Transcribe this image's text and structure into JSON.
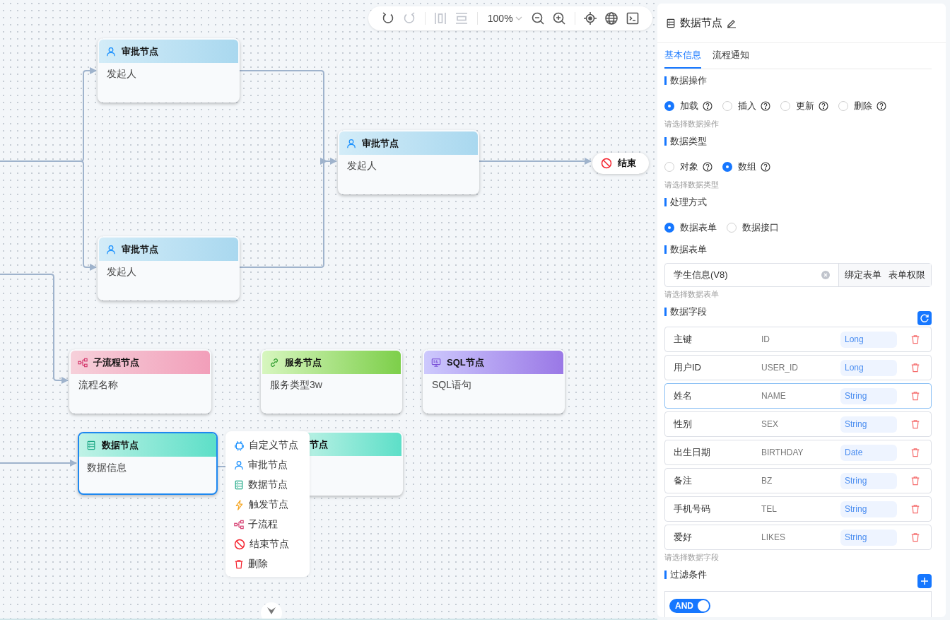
{
  "toolbar": {
    "items": [
      {
        "kind": "undo",
        "disabled": false
      },
      {
        "kind": "redo",
        "disabled": true
      },
      {
        "kind": "sep"
      },
      {
        "kind": "align-v",
        "disabled": true
      },
      {
        "kind": "align-h",
        "disabled": true
      },
      {
        "kind": "sep"
      },
      {
        "kind": "zoom",
        "label": "100%"
      },
      {
        "kind": "zoom-out",
        "disabled": false
      },
      {
        "kind": "zoom-in",
        "disabled": false
      },
      {
        "kind": "sep"
      },
      {
        "kind": "locate",
        "disabled": false
      },
      {
        "kind": "globe",
        "disabled": false
      },
      {
        "kind": "terminal",
        "disabled": false
      }
    ]
  },
  "canvas": {
    "nodes": [
      {
        "kind": "approval",
        "title": "审批节点",
        "body": "发起人",
        "selected": false,
        "covered": false
      },
      {
        "kind": "approval",
        "title": "审批节点",
        "body": "发起人",
        "selected": false,
        "covered": false
      },
      {
        "kind": "approval",
        "title": "审批节点",
        "body": "发起人",
        "selected": false,
        "covered": false
      },
      {
        "kind": "subflow",
        "title": "子流程节点",
        "body": "流程名称",
        "selected": false,
        "covered": false
      },
      {
        "kind": "service",
        "title": "服务节点",
        "body": "服务类型3w",
        "selected": false,
        "covered": false
      },
      {
        "kind": "sql",
        "title": "SQL节点",
        "body": "SQL语句",
        "selected": false,
        "covered": false
      },
      {
        "kind": "data",
        "title": "数据节点",
        "body": "数据信息",
        "selected": true,
        "covered": false
      },
      {
        "kind": "data",
        "title": "节点",
        "selected": false,
        "covered": true
      }
    ],
    "end_node": {
      "label": "结束"
    },
    "context_menu": {
      "items": [
        {
          "kind": "custom",
          "label": "自定义节点"
        },
        {
          "kind": "approval",
          "label": "审批节点"
        },
        {
          "kind": "data",
          "label": "数据节点"
        },
        {
          "kind": "trigger",
          "label": "触发节点"
        },
        {
          "kind": "subflow",
          "label": "子流程"
        },
        {
          "kind": "end",
          "label": "结束节点"
        },
        {
          "kind": "delete",
          "label": "删除"
        }
      ]
    }
  },
  "panel": {
    "title": "数据节点",
    "tabs": [
      {
        "label": "基本信息",
        "selected": true
      },
      {
        "label": "流程通知",
        "selected": false
      }
    ],
    "sections": [
      {
        "kind": "radio",
        "title": "数据操作",
        "options": [
          {
            "label": "加载",
            "help": true,
            "selected": true
          },
          {
            "label": "插入",
            "help": true,
            "selected": false
          },
          {
            "label": "更新",
            "help": true,
            "selected": false
          },
          {
            "label": "删除",
            "help": true,
            "selected": false
          }
        ],
        "hint": "请选择数据操作"
      },
      {
        "kind": "radio",
        "title": "数据类型",
        "options": [
          {
            "label": "对象",
            "help": true,
            "selected": false
          },
          {
            "label": "数组",
            "help": true,
            "selected": true
          }
        ],
        "hint": "请选择数据类型"
      },
      {
        "kind": "radio",
        "title": "处理方式",
        "options": [
          {
            "label": "数据表单",
            "help": false,
            "selected": true
          },
          {
            "label": "数据接口",
            "help": false,
            "selected": false
          }
        ]
      },
      {
        "kind": "select",
        "title": "数据表单",
        "value": "学生信息(V8)",
        "buttons": [
          "绑定表单",
          "表单权限"
        ],
        "hint": "请选择数据表单"
      },
      {
        "kind": "fields",
        "title": "数据字段",
        "rows": [
          {
            "label": "主键",
            "code": "ID",
            "type": "Long",
            "selected": false
          },
          {
            "label": "用户ID",
            "code": "USER_ID",
            "type": "Long",
            "selected": false
          },
          {
            "label": "姓名",
            "code": "NAME",
            "type": "String",
            "selected": true
          },
          {
            "label": "性别",
            "code": "SEX",
            "type": "String",
            "selected": false
          },
          {
            "label": "出生日期",
            "code": "BIRTHDAY",
            "type": "Date",
            "selected": false
          },
          {
            "label": "备注",
            "code": "BZ",
            "type": "String",
            "selected": false
          },
          {
            "label": "手机号码",
            "code": "TEL",
            "type": "String",
            "selected": false
          },
          {
            "label": "爱好",
            "code": "LIKES",
            "type": "String",
            "selected": false
          }
        ],
        "hint": "请选择数据字段"
      },
      {
        "kind": "filter",
        "title": "过滤条件",
        "switch": {
          "label": "AND",
          "on": true
        }
      }
    ]
  }
}
